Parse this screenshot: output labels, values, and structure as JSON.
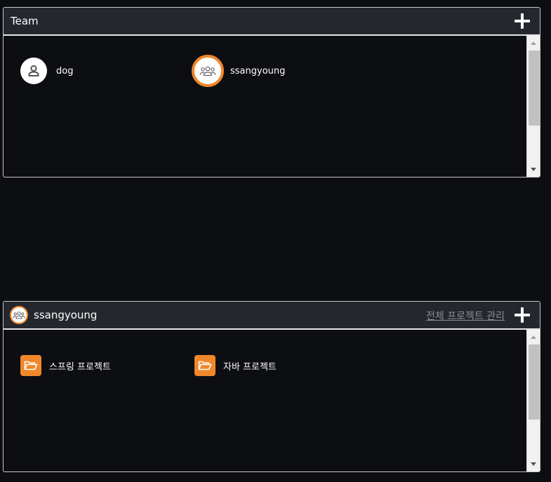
{
  "team_panel": {
    "title": "Team",
    "members": [
      {
        "name": "dog",
        "icon": "user-icon"
      },
      {
        "name": "ssangyoung",
        "icon": "group-icon",
        "selected": true
      }
    ]
  },
  "project_panel": {
    "team_name": "ssangyoung",
    "manage_link": "전체 프로젝트 관리",
    "projects": [
      {
        "name": "스프링 프로젝트",
        "icon": "folder-open-icon"
      },
      {
        "name": "자바 프로젝트",
        "icon": "folder-open-icon"
      }
    ]
  },
  "colors": {
    "accent": "#f0872a",
    "background": "#0d0e12",
    "header": "#25272e",
    "link": "#8a8c92"
  }
}
